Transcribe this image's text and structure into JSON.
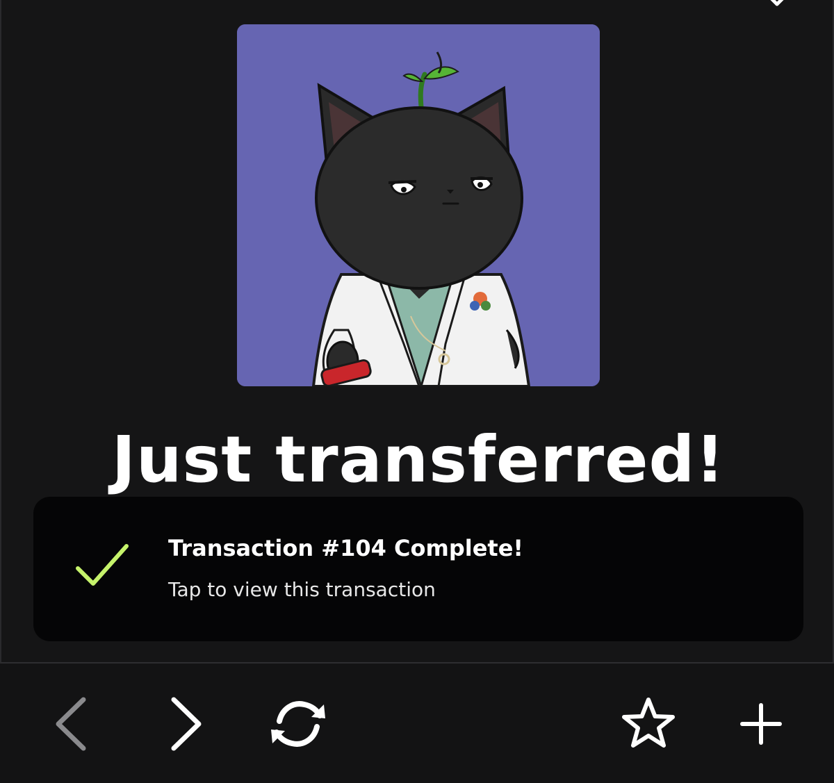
{
  "modal": {
    "headline": "Just transferred!",
    "nft_image": {
      "alt": "Black cat in white lab coat with a sprout on its head, holding a red can",
      "background_color": "#6665b2"
    },
    "transaction_card": {
      "title": "Transaction #104 Complete!",
      "subtitle": "Tap to view this transaction",
      "check_color": "#c6f36b"
    }
  },
  "toolbar": {
    "back_icon": "chevron-left-icon",
    "forward_icon": "chevron-right-icon",
    "reload_icon": "reload-icon",
    "bookmark_icon": "star-icon",
    "new_tab_icon": "plus-icon",
    "back_enabled": false
  }
}
